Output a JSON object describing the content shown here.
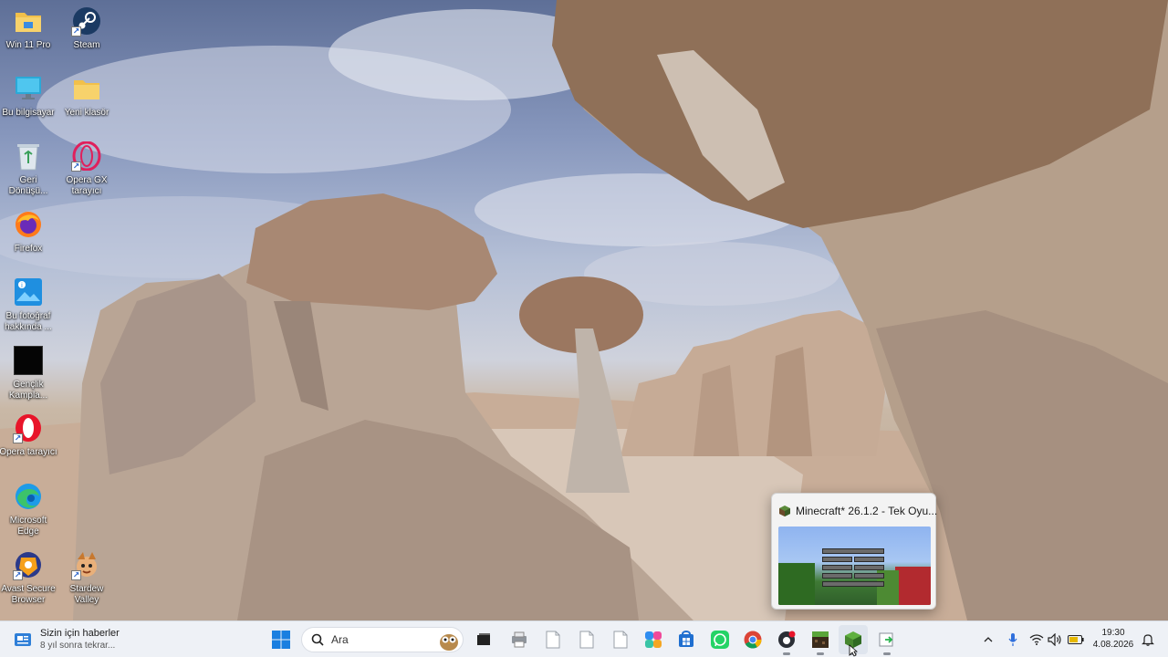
{
  "desktop": {
    "icons": [
      {
        "label": "Win 11 Pro",
        "icon": "folder-icon"
      },
      {
        "label": "Steam",
        "icon": "steam-icon"
      },
      {
        "label": "Bu bilgisayar",
        "icon": "computer-icon"
      },
      {
        "label": "Yeni klasör",
        "icon": "folder-icon"
      },
      {
        "label": "Geri Dönüşü...",
        "icon": "recycle-bin-icon"
      },
      {
        "label": "Opera GX tarayıcı",
        "icon": "opera-gx-icon"
      },
      {
        "label": "Firefox",
        "icon": "firefox-icon"
      },
      {
        "label": "Bu fotoğraf hakkında ...",
        "icon": "photo-info-icon"
      },
      {
        "label": "Gençlik Kampla...",
        "icon": "black-app-icon"
      },
      {
        "label": "Opera tarayıcı",
        "icon": "opera-icon"
      },
      {
        "label": "Microsoft Edge",
        "icon": "edge-icon"
      },
      {
        "label": "Avast Secure Browser",
        "icon": "avast-icon"
      },
      {
        "label": "Stardew Valley",
        "icon": "stardew-valley-icon"
      }
    ]
  },
  "preview": {
    "title": "Minecraft* 26.1.2 - Tek Oyu...",
    "icon": "minecraft-icon"
  },
  "taskbar": {
    "news_title": "Sizin için haberler",
    "news_subtitle": "8 yıl sonra tekrar...",
    "search_placeholder": "Ara",
    "apps": [
      "windows-start-icon",
      "file-explorer-icon",
      "printer-icon",
      "document-icon",
      "document-icon",
      "document-icon",
      "copilot-icon",
      "store-icon",
      "whatsapp-icon",
      "chrome-icon",
      "github-desktop-icon",
      "minecraft-launcher-icon",
      "minecraft-icon",
      "terminal-icon"
    ],
    "time": "19:30",
    "date": "4.08.2026"
  },
  "colors": {
    "taskbar_bg": "#eef1f6",
    "accent": "#0067c0"
  }
}
